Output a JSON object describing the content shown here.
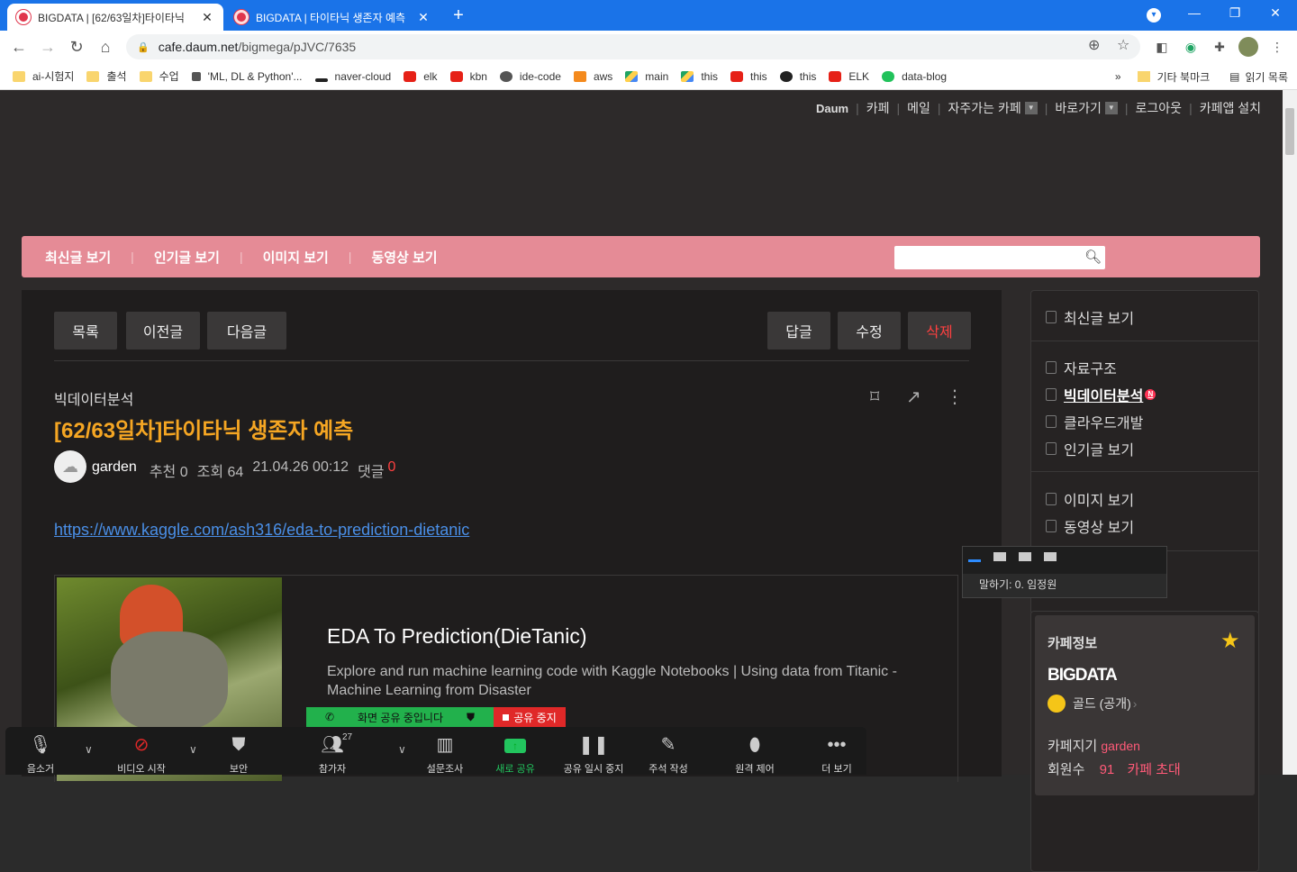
{
  "browser": {
    "tabs": [
      {
        "title": "BIGDATA | [62/63일차]타이타닉",
        "active": true
      },
      {
        "title": "BIGDATA | 타이타닉 생존자 예측",
        "active": false
      }
    ],
    "url_domain": "cafe.daum.net",
    "url_path": "/bigmega/pJVC/7635"
  },
  "bookmarks": {
    "items": [
      {
        "label": "ai-시험지",
        "icon": "folder"
      },
      {
        "label": "출석",
        "icon": "folder"
      },
      {
        "label": "수업",
        "icon": "folder"
      },
      {
        "label": "'ML, DL & Python'...",
        "icon": "dots"
      },
      {
        "label": "naver-cloud",
        "icon": "nc"
      },
      {
        "label": "elk",
        "icon": "yt"
      },
      {
        "label": "kbn",
        "icon": "yt"
      },
      {
        "label": "ide-code",
        "icon": "ide"
      },
      {
        "label": "aws",
        "icon": "aws"
      },
      {
        "label": "main",
        "icon": "gd"
      },
      {
        "label": "this",
        "icon": "gd"
      },
      {
        "label": "this",
        "icon": "yt"
      },
      {
        "label": "this",
        "icon": "gh"
      },
      {
        "label": "ELK",
        "icon": "yt"
      },
      {
        "label": "data-blog",
        "icon": "blog"
      }
    ],
    "more": "»",
    "other": "기타 북마크",
    "reading": "읽기 목록"
  },
  "daumnav": {
    "daum": "Daum",
    "cafe": "카페",
    "mail": "메일",
    "frequent": "자주가는 카페",
    "goto": "바로가기",
    "logout": "로그아웃",
    "install": "카페앱 설치"
  },
  "pinkbar": {
    "menus": [
      "최신글 보기",
      "인기글 보기",
      "이미지 보기",
      "동영상 보기"
    ]
  },
  "post": {
    "buttons_left": [
      "목록",
      "이전글",
      "다음글"
    ],
    "buttons_right": [
      "답글",
      "수정",
      "삭제"
    ],
    "category": "빅데이터분석",
    "title": "[62/63일차]타이타닉 생존자 예측",
    "author": "garden",
    "recommend": "추천 0",
    "views": "조회 64",
    "date": "21.04.26 00:12",
    "comments_label": "댓글",
    "comments_count": "0",
    "link": "https://www.kaggle.com/ash316/eda-to-prediction-dietanic",
    "card_title": "EDA To Prediction(DieTanic)",
    "card_desc": "Explore and run machine learning code with Kaggle Notebooks | Using data from Titanic - Machine Learning from Disaster"
  },
  "sidebar": {
    "group1": [
      "최신글 보기"
    ],
    "group2": [
      "자료구조",
      "빅데이터분석",
      "클라우드개발",
      "인기글 보기"
    ],
    "new_badge": "N",
    "group3": [
      "이미지 보기",
      "동영상 보기"
    ]
  },
  "cafeinfo": {
    "header": "카페정보",
    "name": "BIGDATA",
    "level": "골드 (공개)",
    "manager_label": "카페지기",
    "manager": "garden",
    "members_label": "회원수",
    "members": "91",
    "invite": "카페 초대"
  },
  "zoom": {
    "speaking": "말하기: 0. 임정원",
    "sharing": "화면 공유 중입니다",
    "stop": "공유 중지",
    "participants_count": "27",
    "toolbar": [
      "음소거",
      "비디오 시작",
      "보안",
      "참가자",
      "설문조사",
      "새로 공유",
      "공유 일시 중지",
      "주석 작성",
      "원격 제어",
      "더 보기"
    ]
  }
}
